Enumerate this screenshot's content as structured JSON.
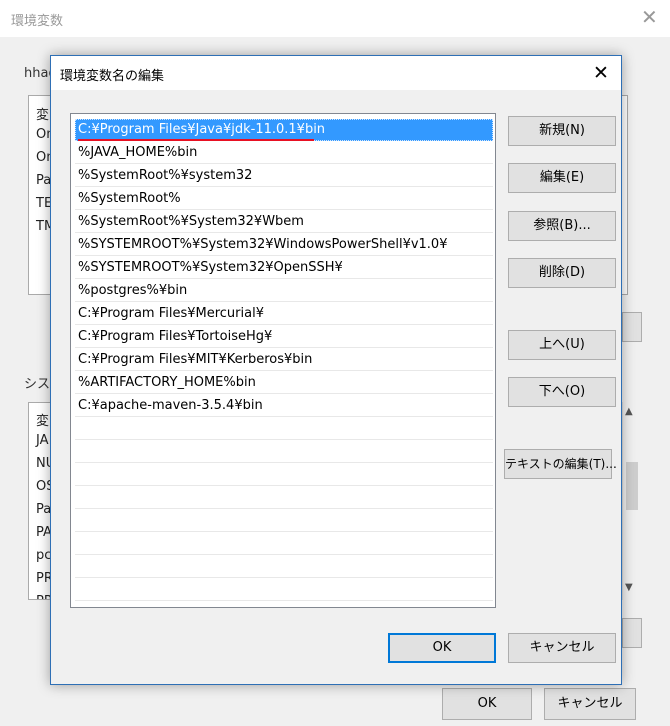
{
  "background_window": {
    "title": "環境変数",
    "close_symbol": "✕",
    "user_section_label": "hhag",
    "user_rows": [
      "変",
      "On",
      "On",
      "Pa",
      "TE",
      "TM"
    ],
    "system_section_label": "シス",
    "system_rows": [
      "変",
      "JA",
      "NU",
      "OS",
      "Pa",
      "PA",
      "pc",
      "PR",
      "PR"
    ],
    "ok_label": "OK",
    "cancel_label": "キャンセル"
  },
  "dialog": {
    "title": "環境変数名の編集",
    "close_symbol": "✕",
    "paths": [
      "C:¥Program Files¥Java¥jdk-11.0.1¥bin",
      "%JAVA_HOME%bin",
      "%SystemRoot%¥system32",
      "%SystemRoot%",
      "%SystemRoot%¥System32¥Wbem",
      "%SYSTEMROOT%¥System32¥WindowsPowerShell¥v1.0¥",
      "%SYSTEMROOT%¥System32¥OpenSSH¥",
      "%postgres%¥bin",
      "C:¥Program Files¥Mercurial¥",
      "C:¥Program Files¥TortoiseHg¥",
      "C:¥Program Files¥MIT¥Kerberos¥bin",
      "%ARTIFACTORY_HOME%bin",
      "C:¥apache-maven-3.5.4¥bin"
    ],
    "selected_index": 0,
    "buttons": {
      "new": "新規(N)",
      "edit": "編集(E)",
      "browse": "参照(B)...",
      "delete": "削除(D)",
      "up": "上へ(U)",
      "down": "下へ(O)",
      "edit_text": "テキストの編集(T)...",
      "ok": "OK",
      "cancel": "キャンセル"
    },
    "accent_color": "#0078d7",
    "selection_color": "#3399ff",
    "highlight_color": "#e81123"
  }
}
